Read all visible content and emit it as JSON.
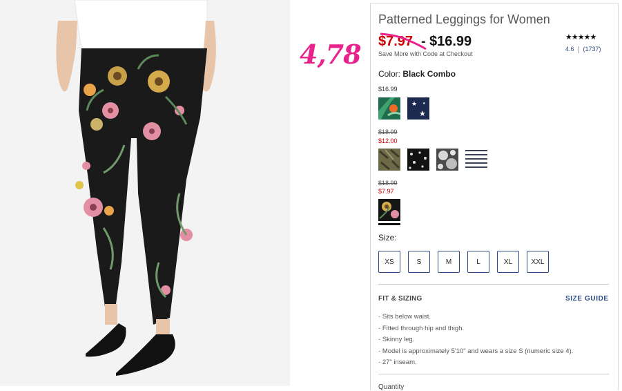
{
  "annotation": {
    "handwritten_price": "4,78",
    "color": "#e8248c"
  },
  "product": {
    "title": "Patterned Leggings for Women",
    "old_price": "$7.97",
    "price_separator": "-",
    "price": "$16.99",
    "promo_text": "Save More with Code at Checkout",
    "stars": "★★★★★",
    "rating_value": "4.6",
    "review_count": "(1737)"
  },
  "color": {
    "label": "Color:",
    "selected": "Black Combo",
    "tiers": [
      {
        "price": "$16.99",
        "swatches": [
          "green-tropical-swatch",
          "navy-star-swatch"
        ]
      },
      {
        "was": "$18.99",
        "now": "$12.00",
        "swatches": [
          "olive-leaf-swatch",
          "black-dot-swatch",
          "gray-floral-swatch",
          "stripe-swatch"
        ]
      },
      {
        "was": "$18.99",
        "now": "$7.97",
        "swatches": [
          "black-combo-swatch"
        ]
      }
    ]
  },
  "size": {
    "label": "Size:",
    "options": [
      "XS",
      "S",
      "M",
      "L",
      "XL",
      "XXL"
    ]
  },
  "fit": {
    "title": "FIT & SIZING",
    "size_guide": "SIZE GUIDE",
    "bullets": [
      "Sits below waist.",
      "Fitted through hip and thigh.",
      "Skinny leg.",
      "Model is approximately 5'10\" and wears a size S (numeric size 4).",
      "27\" inseam."
    ]
  },
  "quantity_label": "Quantity",
  "colors": {
    "link": "#2c4a84",
    "sale": "#cc0000",
    "note": "#e8248c"
  }
}
